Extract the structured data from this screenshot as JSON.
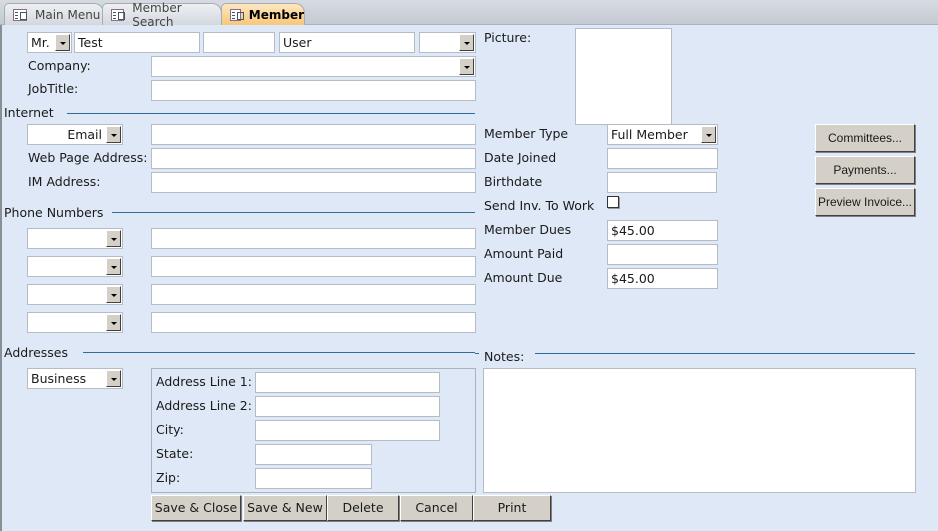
{
  "tabs": [
    {
      "label": "Main Menu",
      "icon": "form-icon",
      "active": false
    },
    {
      "label": "Member Search",
      "icon": "form-icon",
      "active": false
    },
    {
      "label": "Member",
      "icon": "form-icon",
      "active": true
    }
  ],
  "name": {
    "prefix": "Mr.",
    "first": "Test",
    "middle": "",
    "last": "User",
    "suffix": ""
  },
  "company": {
    "label": "Company:",
    "value": ""
  },
  "job_title": {
    "label": "JobTitle:",
    "value": ""
  },
  "internet": {
    "section": "Internet",
    "email_type": "Email",
    "email_value": "",
    "web_label": "Web Page Address:",
    "web_value": "",
    "im_label": "IM Address:",
    "im_value": ""
  },
  "phones": {
    "section": "Phone Numbers",
    "rows": [
      {
        "type": "",
        "number": ""
      },
      {
        "type": "",
        "number": ""
      },
      {
        "type": "",
        "number": ""
      },
      {
        "type": "",
        "number": ""
      }
    ]
  },
  "addresses": {
    "section": "Addresses",
    "type": "Business",
    "line1_label": "Address Line 1:",
    "line1": "",
    "line2_label": "Address Line 2:",
    "line2": "",
    "city_label": "City:",
    "city": "",
    "state_label": "State:",
    "state": "",
    "zip_label": "Zip:",
    "zip": ""
  },
  "picture_label": "Picture:",
  "membership": {
    "type_label": "Member Type",
    "type_value": "Full Member",
    "joined_label": "Date Joined",
    "joined_value": "",
    "birthdate_label": "Birthdate",
    "birthdate_value": "",
    "send_inv_label": "Send Inv. To Work",
    "send_inv_checked": false,
    "dues_label": "Member Dues",
    "dues_value": "$45.00",
    "paid_label": "Amount Paid",
    "paid_value": "",
    "due_label": "Amount Due",
    "due_value": "$45.00"
  },
  "side_buttons": {
    "committees": "Committees...",
    "payments": "Payments...",
    "preview_invoice": "Preview Invoice..."
  },
  "notes": {
    "label": "Notes:",
    "value": ""
  },
  "actions": {
    "save_close": "Save & Close",
    "save_new": "Save & New",
    "delete": "Delete",
    "cancel": "Cancel",
    "print": "Print"
  }
}
